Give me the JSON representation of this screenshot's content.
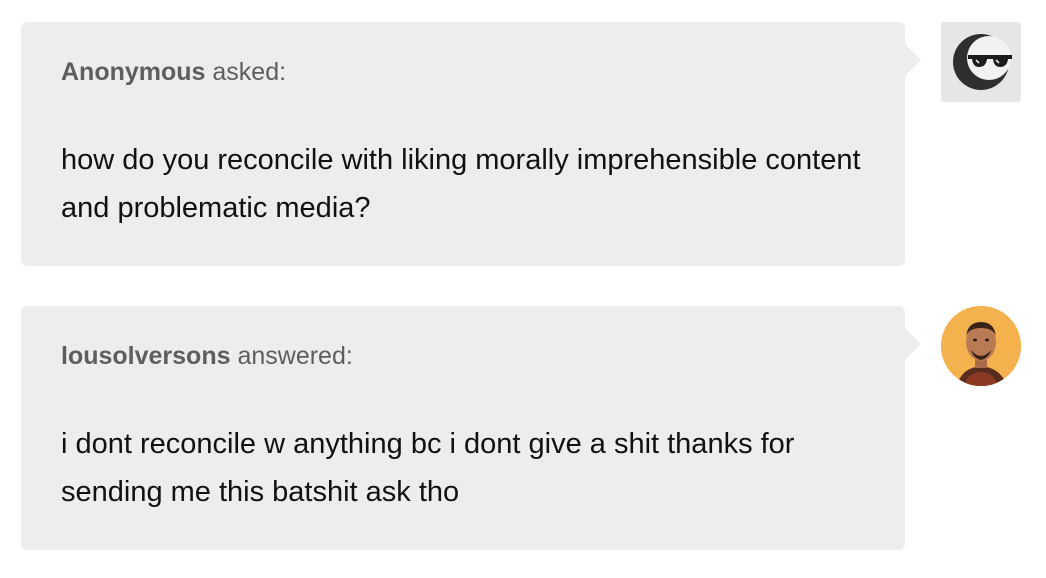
{
  "ask": {
    "author": "Anonymous",
    "verb": "asked:",
    "text": "how do you reconcile with liking morally imprehensible content and problematic media?"
  },
  "answer": {
    "author": "lousolversons",
    "verb": "answered:",
    "text": "i dont reconcile w anything bc i dont give a shit thanks for sending me this batshit ask tho"
  },
  "colors": {
    "bubble": "#ededed",
    "meta_text": "#5e5e5e",
    "body_text": "#111111",
    "avatar_user_bg": "#f4b24f"
  },
  "icons": {
    "anon_avatar": "anonymous-sunglasses-icon",
    "user_avatar": "user-photo"
  }
}
